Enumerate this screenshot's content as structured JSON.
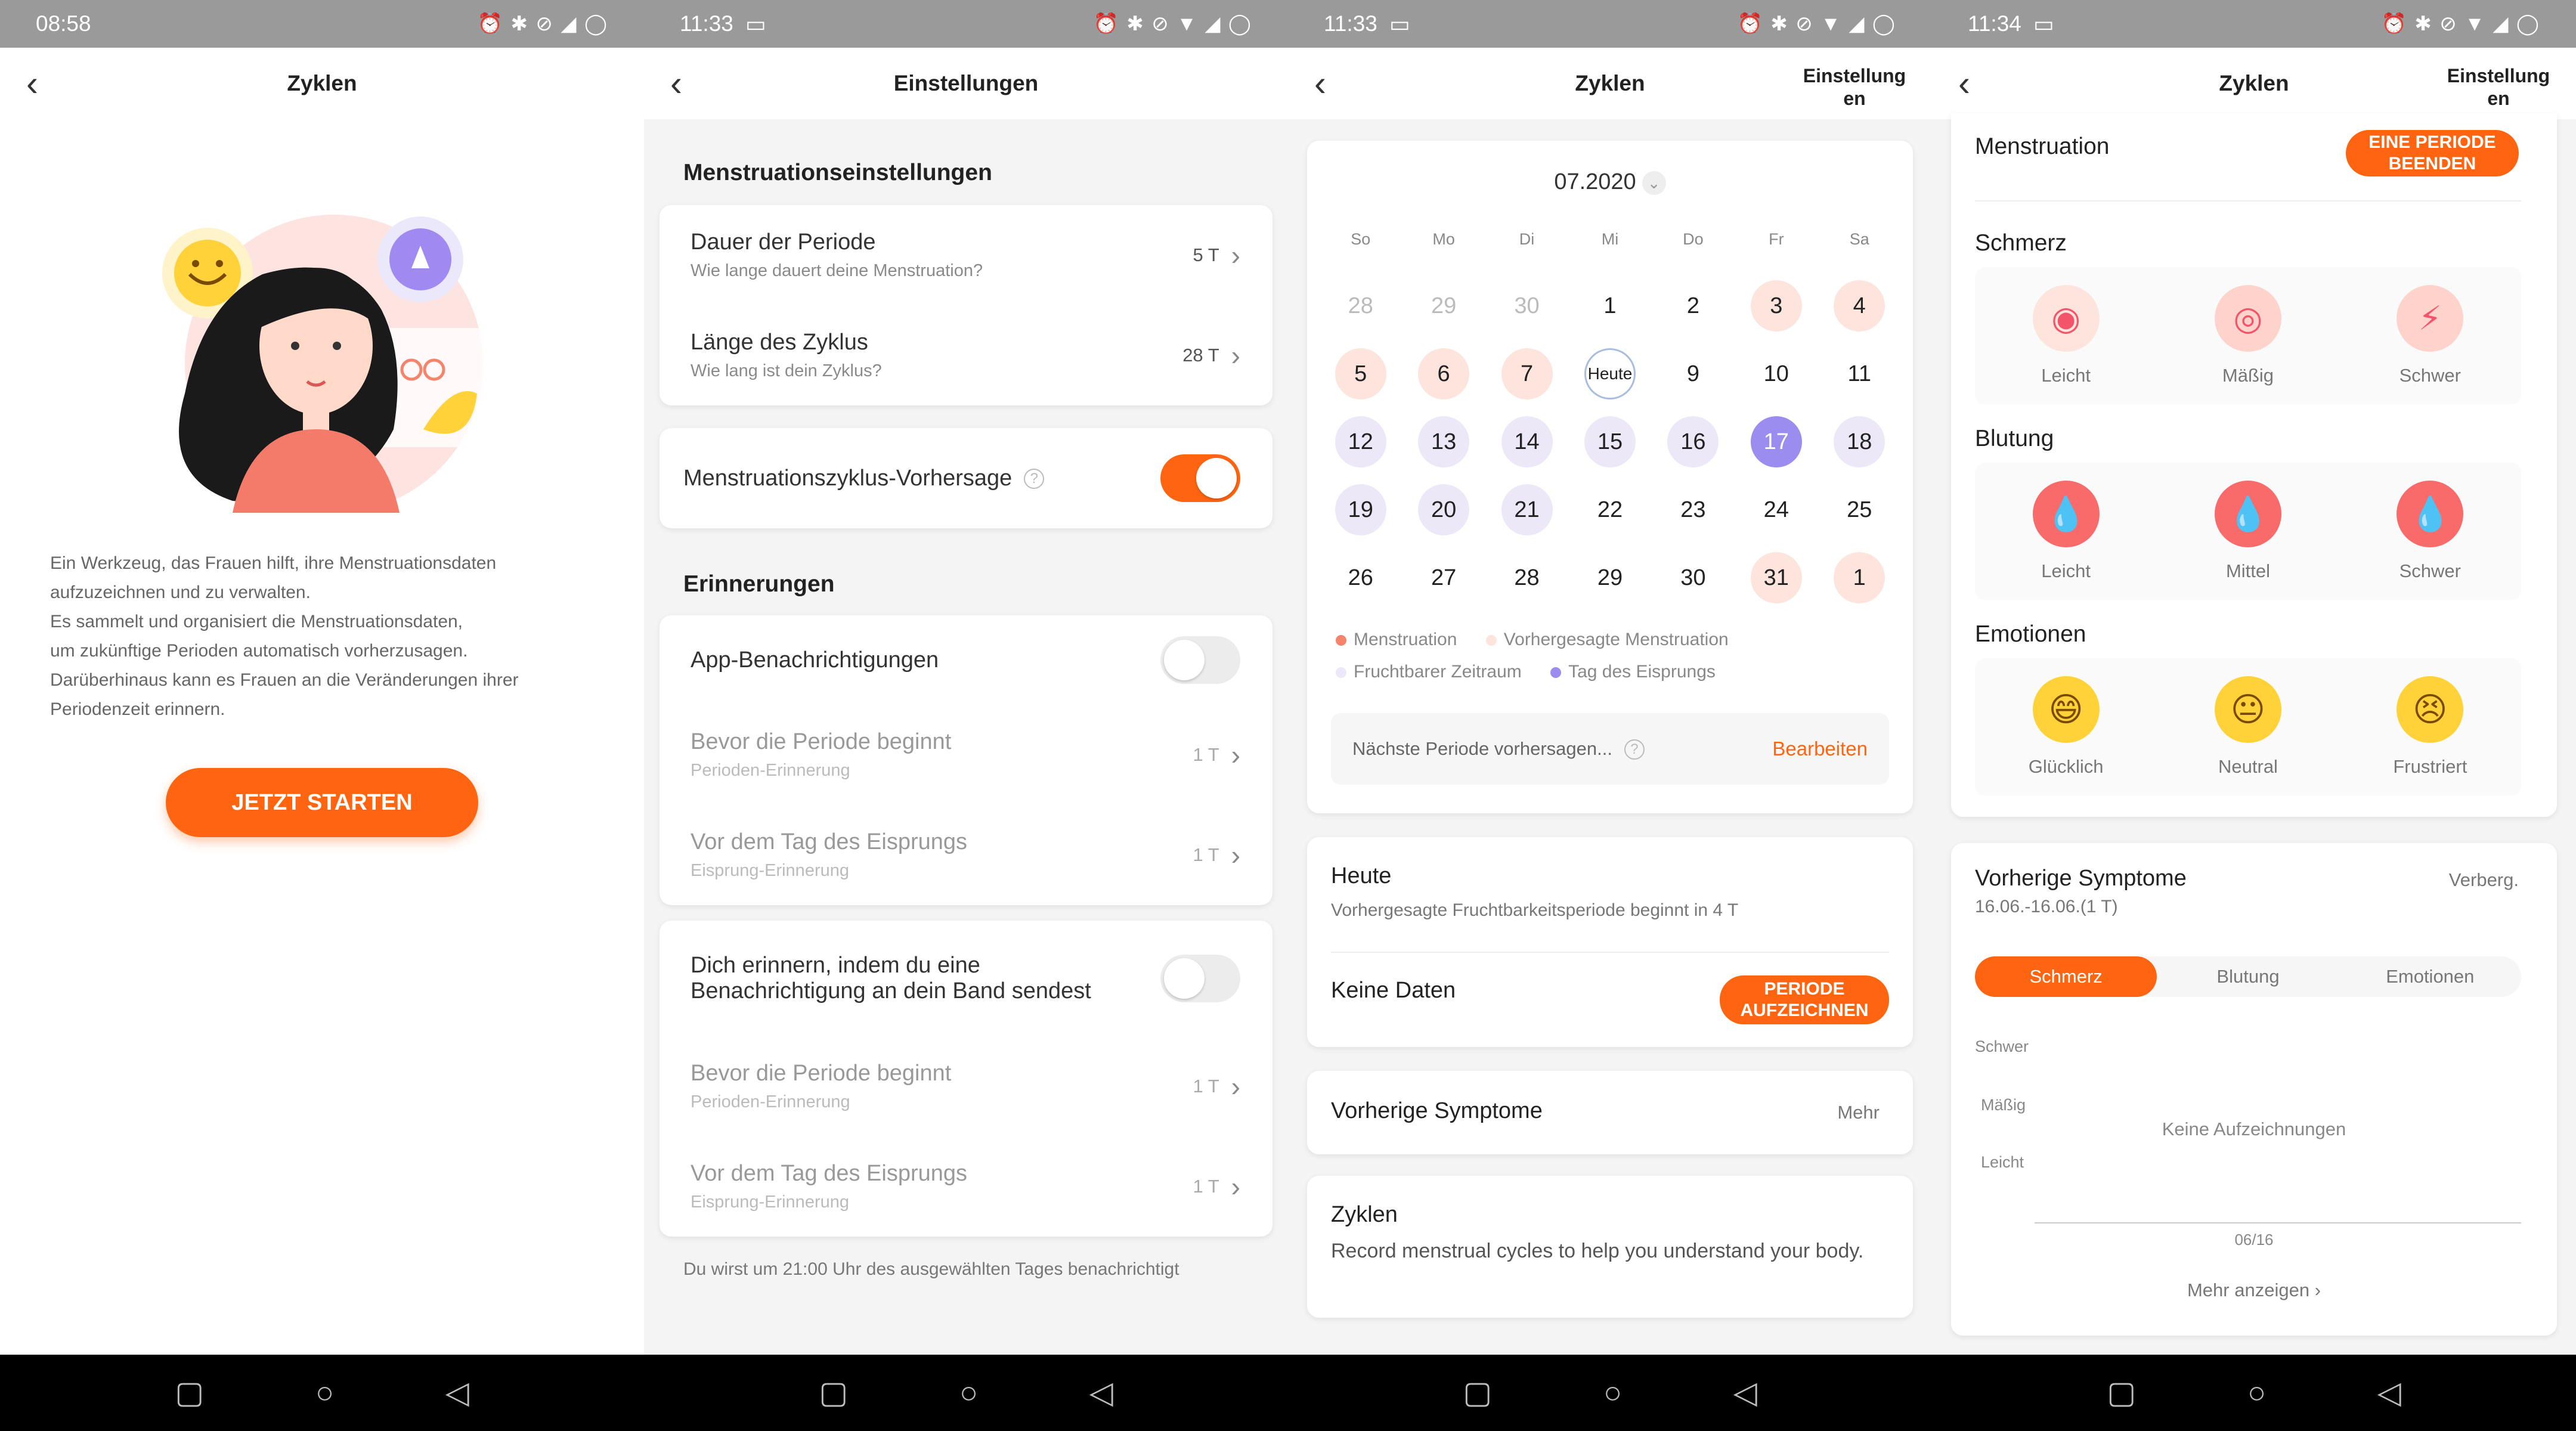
{
  "panel1": {
    "time": "08:58",
    "title": "Zyklen",
    "description": [
      "Ein Werkzeug, das Frauen hilft, ihre Menstruationsdaten",
      "aufzuzeichnen und zu verwalten.",
      "Es sammelt und organisiert die Menstruationsdaten,",
      "um zukünftige Perioden automatisch vorherzusagen.",
      "Darüberhinaus kann es Frauen an die Veränderungen ihrer",
      "Periodenzeit erinnern."
    ],
    "start_label": "JETZT STARTEN"
  },
  "panel2": {
    "time": "11:33",
    "title": "Einstellungen",
    "section1": "Menstruationseinstellungen",
    "period_duration": {
      "title": "Dauer der Periode",
      "subtitle": "Wie lange dauert deine Menstruation?",
      "value": "5 T"
    },
    "cycle_length": {
      "title": "Länge des Zyklus",
      "subtitle": "Wie lang ist dein Zyklus?",
      "value": "28 T"
    },
    "prediction_label": "Menstruationszyklus-Vorhersage",
    "section2": "Erinnerungen",
    "app_notifications": "App-Benachrichtigungen",
    "before_period": {
      "title": "Bevor die Periode beginnt",
      "subtitle": "Perioden-Erinnerung",
      "value": "1 T"
    },
    "before_ovulation": {
      "title": "Vor dem Tag des Eisprungs",
      "subtitle": "Eisprung-Erinnerung",
      "value": "1 T"
    },
    "band_reminder": [
      "Dich erinnern, indem du eine",
      "Benachrichtigung an dein Band sendest"
    ],
    "before_period2": {
      "title": "Bevor die Periode beginnt",
      "subtitle": "Perioden-Erinnerung",
      "value": "1 T"
    },
    "before_ovulation2": {
      "title": "Vor dem Tag des Eisprungs",
      "subtitle": "Eisprung-Erinnerung",
      "value": "1 T"
    },
    "footer": "Du wirst um 21:00 Uhr des ausgewählten Tages benachrichtigt"
  },
  "panel3": {
    "time": "11:33",
    "title": "Zyklen",
    "settings": [
      "Einstellung",
      "en"
    ],
    "month": "07.2020",
    "weekdays": [
      "So",
      "Mo",
      "Di",
      "Mi",
      "Do",
      "Fr",
      "Sa"
    ],
    "weeks": [
      [
        {
          "d": "28",
          "c": "out"
        },
        {
          "d": "29",
          "c": "out"
        },
        {
          "d": "30",
          "c": "out"
        },
        {
          "d": "1",
          "c": ""
        },
        {
          "d": "2",
          "c": ""
        },
        {
          "d": "3",
          "c": "mens"
        },
        {
          "d": "4",
          "c": "mens"
        }
      ],
      [
        {
          "d": "5",
          "c": "mens"
        },
        {
          "d": "6",
          "c": "mens"
        },
        {
          "d": "7",
          "c": "mens"
        },
        {
          "d": "Heute",
          "c": "today"
        },
        {
          "d": "9",
          "c": ""
        },
        {
          "d": "10",
          "c": ""
        },
        {
          "d": "11",
          "c": ""
        }
      ],
      [
        {
          "d": "12",
          "c": "fert"
        },
        {
          "d": "13",
          "c": "fert"
        },
        {
          "d": "14",
          "c": "fert"
        },
        {
          "d": "15",
          "c": "fert"
        },
        {
          "d": "16",
          "c": "fert"
        },
        {
          "d": "17",
          "c": "ovul"
        },
        {
          "d": "18",
          "c": "fert"
        }
      ],
      [
        {
          "d": "19",
          "c": "fert"
        },
        {
          "d": "20",
          "c": "fert"
        },
        {
          "d": "21",
          "c": "fert"
        },
        {
          "d": "22",
          "c": ""
        },
        {
          "d": "23",
          "c": ""
        },
        {
          "d": "24",
          "c": ""
        },
        {
          "d": "25",
          "c": ""
        }
      ],
      [
        {
          "d": "26",
          "c": ""
        },
        {
          "d": "27",
          "c": ""
        },
        {
          "d": "28",
          "c": ""
        },
        {
          "d": "29",
          "c": ""
        },
        {
          "d": "30",
          "c": ""
        },
        {
          "d": "31",
          "c": "mens"
        },
        {
          "d": "1",
          "c": "mens"
        }
      ]
    ],
    "legend": {
      "mens": "Menstruation",
      "pred": "Vorhergesagte Menstruation",
      "fert": "Fruchtbarer Zeitraum",
      "ovul": "Tag des Eisprungs"
    },
    "predict_label": "Nächste Periode vorhersagen...",
    "edit": "Bearbeiten",
    "today_title": "Heute",
    "today_sub": "Vorhergesagte Fruchtbarkeitsperiode beginnt in 4 T",
    "no_data": "Keine Daten",
    "record": [
      "PERIODE",
      "AUFZEICHNEN"
    ],
    "prev_symptoms": "Vorherige Symptome",
    "more": "Mehr",
    "cycles_title": "Zyklen",
    "cycles_desc": "Record menstrual cycles to help you understand your body."
  },
  "panel4": {
    "time": "11:34",
    "title": "Zyklen",
    "settings": [
      "Einstellung",
      "en"
    ],
    "menstruation": "Menstruation",
    "end_period": [
      "EINE PERIODE",
      "BEENDEN"
    ],
    "pain": "Schmerz",
    "pain_items": [
      "Leicht",
      "Mäßig",
      "Schwer"
    ],
    "bleeding": "Blutung",
    "bleeding_items": [
      "Leicht",
      "Mittel",
      "Schwer"
    ],
    "emotions": "Emotionen",
    "emotion_items": [
      "Glücklich",
      "Neutral",
      "Frustriert"
    ],
    "prev_symptoms": "Vorherige Symptome",
    "hide": "Verberg.",
    "range": "16.06.-16.06.(1 T)",
    "tabs": [
      "Schmerz",
      "Blutung",
      "Emotionen"
    ],
    "levels": [
      "Schwer",
      "Mäßig",
      "Leicht"
    ],
    "no_records": "Keine Aufzeichnungen",
    "xtick": "06/16",
    "show_more": "Mehr anzeigen"
  },
  "colors": {
    "accent": "#ff6510",
    "mens": "#f4846a",
    "fert": "#ece8f8",
    "ovul": "#9b8cf0"
  }
}
